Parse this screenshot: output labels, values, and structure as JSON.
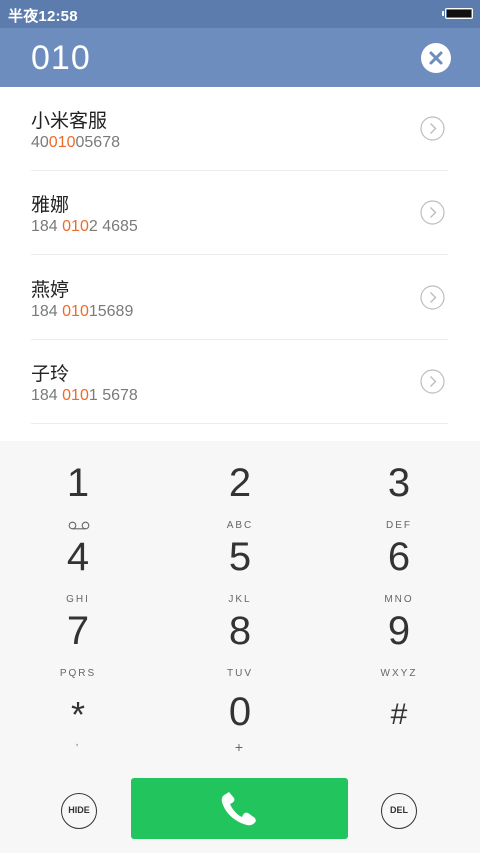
{
  "status_bar": {
    "time": "半夜12:58"
  },
  "header": {
    "dialed_number": "010"
  },
  "contacts": [
    {
      "name": "小米客服",
      "phone_pre": "40",
      "phone_match": "010",
      "phone_post": "05678"
    },
    {
      "name": "雅娜",
      "phone_pre": "184 ",
      "phone_match": "010",
      "phone_post": "2 4685"
    },
    {
      "name": "燕婷",
      "phone_pre": "184 ",
      "phone_match": "010",
      "phone_post": "15689"
    },
    {
      "name": "子玲",
      "phone_pre": "184 ",
      "phone_match": "010",
      "phone_post": "1 5678"
    }
  ],
  "keypad": [
    {
      "digit": "1",
      "letters": ""
    },
    {
      "digit": "2",
      "letters": "ABC"
    },
    {
      "digit": "3",
      "letters": "DEF"
    },
    {
      "digit": "4",
      "letters": "GHI"
    },
    {
      "digit": "5",
      "letters": "JKL"
    },
    {
      "digit": "6",
      "letters": "MNO"
    },
    {
      "digit": "7",
      "letters": "PQRS"
    },
    {
      "digit": "8",
      "letters": "TUV"
    },
    {
      "digit": "9",
      "letters": "WXYZ"
    },
    {
      "digit": "*",
      "letters": ","
    },
    {
      "digit": "0",
      "letters": "+"
    },
    {
      "digit": "#",
      "letters": ""
    }
  ],
  "bottom": {
    "hide_label": "HIDE",
    "del_label": "DEL"
  },
  "icons": {
    "clear": "close-icon",
    "arrow": "chevron-right-circle-icon",
    "voicemail": "voicemail-icon",
    "call": "phone-icon"
  },
  "colors": {
    "status_bar": "#5c7cae",
    "header": "#6d8dbf",
    "highlight": "#ee6a28",
    "call_button": "#22c55d"
  }
}
